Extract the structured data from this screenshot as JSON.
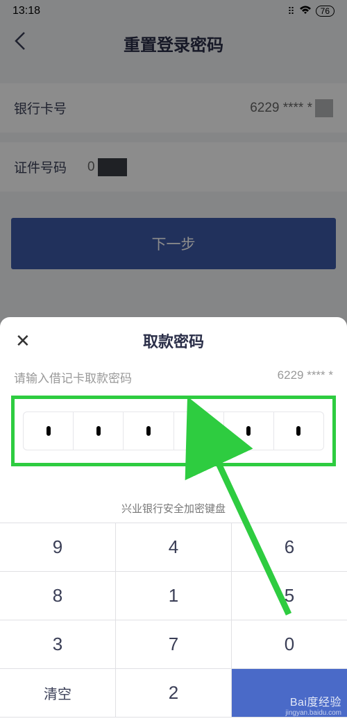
{
  "statusBar": {
    "time": "13:18",
    "battery": "76"
  },
  "header": {
    "title": "重置登录密码"
  },
  "form": {
    "cardLabel": "银行卡号",
    "cardValue": "6229 ****       *",
    "idLabel": "证件号码",
    "idValue": "0"
  },
  "nextButton": "下一步",
  "modal": {
    "title": "取款密码",
    "hint": "请输入借记卡取款密码",
    "cardMasked": "6229 ****       *"
  },
  "keyboard": {
    "label": "兴业银行安全加密键盘",
    "keys": {
      "r1c1": "9",
      "r1c2": "4",
      "r1c3": "6",
      "r2c1": "8",
      "r2c2": "1",
      "r2c3": "5",
      "r3c1": "3",
      "r3c2": "7",
      "r3c3": "0",
      "r4c1": "清空",
      "r4c2": "2"
    }
  },
  "watermark": {
    "brand": "Bai度经验",
    "url": "jingyan.baidu.com"
  }
}
